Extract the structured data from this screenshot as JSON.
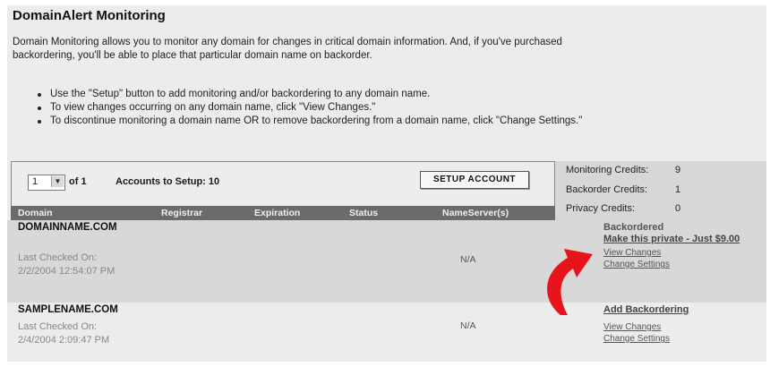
{
  "title": "DomainAlert Monitoring",
  "intro": "Domain Monitoring allows you to monitor any domain for changes in critical domain information. And, if you've purchased backordering, you'll be able to place that particular domain name on backorder.",
  "bullets": [
    "Use the \"Setup\" button to add monitoring and/or backordering to any domain name.",
    "To view changes occurring on any domain name, click \"View Changes.\"",
    "To discontinue monitoring a domain name OR to remove backordering from a domain name, click \"Change Settings.\""
  ],
  "accounts": {
    "page_value": "1",
    "of_label": "of 1",
    "setup_label": "Accounts to Setup: 10",
    "setup_button": "SETUP ACCOUNT"
  },
  "columns": [
    "Domain",
    "Registrar",
    "Expiration",
    "Status",
    "NameServer(s)"
  ],
  "credits": [
    {
      "label": "Monitoring Credits:",
      "value": "9"
    },
    {
      "label": "Backorder Credits:",
      "value": "1"
    },
    {
      "label": "Privacy Credits:",
      "value": "0"
    }
  ],
  "domains": [
    {
      "name": "DOMAINNAME.COM",
      "checked_label": "Last Checked On:",
      "checked_date": "2/2/2004 12:54:07 PM",
      "nameserver": "N/A",
      "status": "Backordered",
      "private_link": "Make this private - Just $9.00",
      "view_changes": "View Changes",
      "change_settings": "Change Settings"
    },
    {
      "name": "SAMPLENAME.COM",
      "checked_label": "Last Checked On:",
      "checked_date": "2/4/2004 2:09:47 PM",
      "nameserver": "N/A",
      "add_backorder": "Add Backordering",
      "view_changes": "View Changes",
      "change_settings": "Change Settings"
    }
  ],
  "colors": {
    "arrow": "#e8141b",
    "header_bg": "#6b6b6b",
    "panel_bg": "#ececec"
  },
  "icons": {
    "arrow": "red-curved-arrow-icon",
    "dropdown": "chevron-down-icon"
  }
}
